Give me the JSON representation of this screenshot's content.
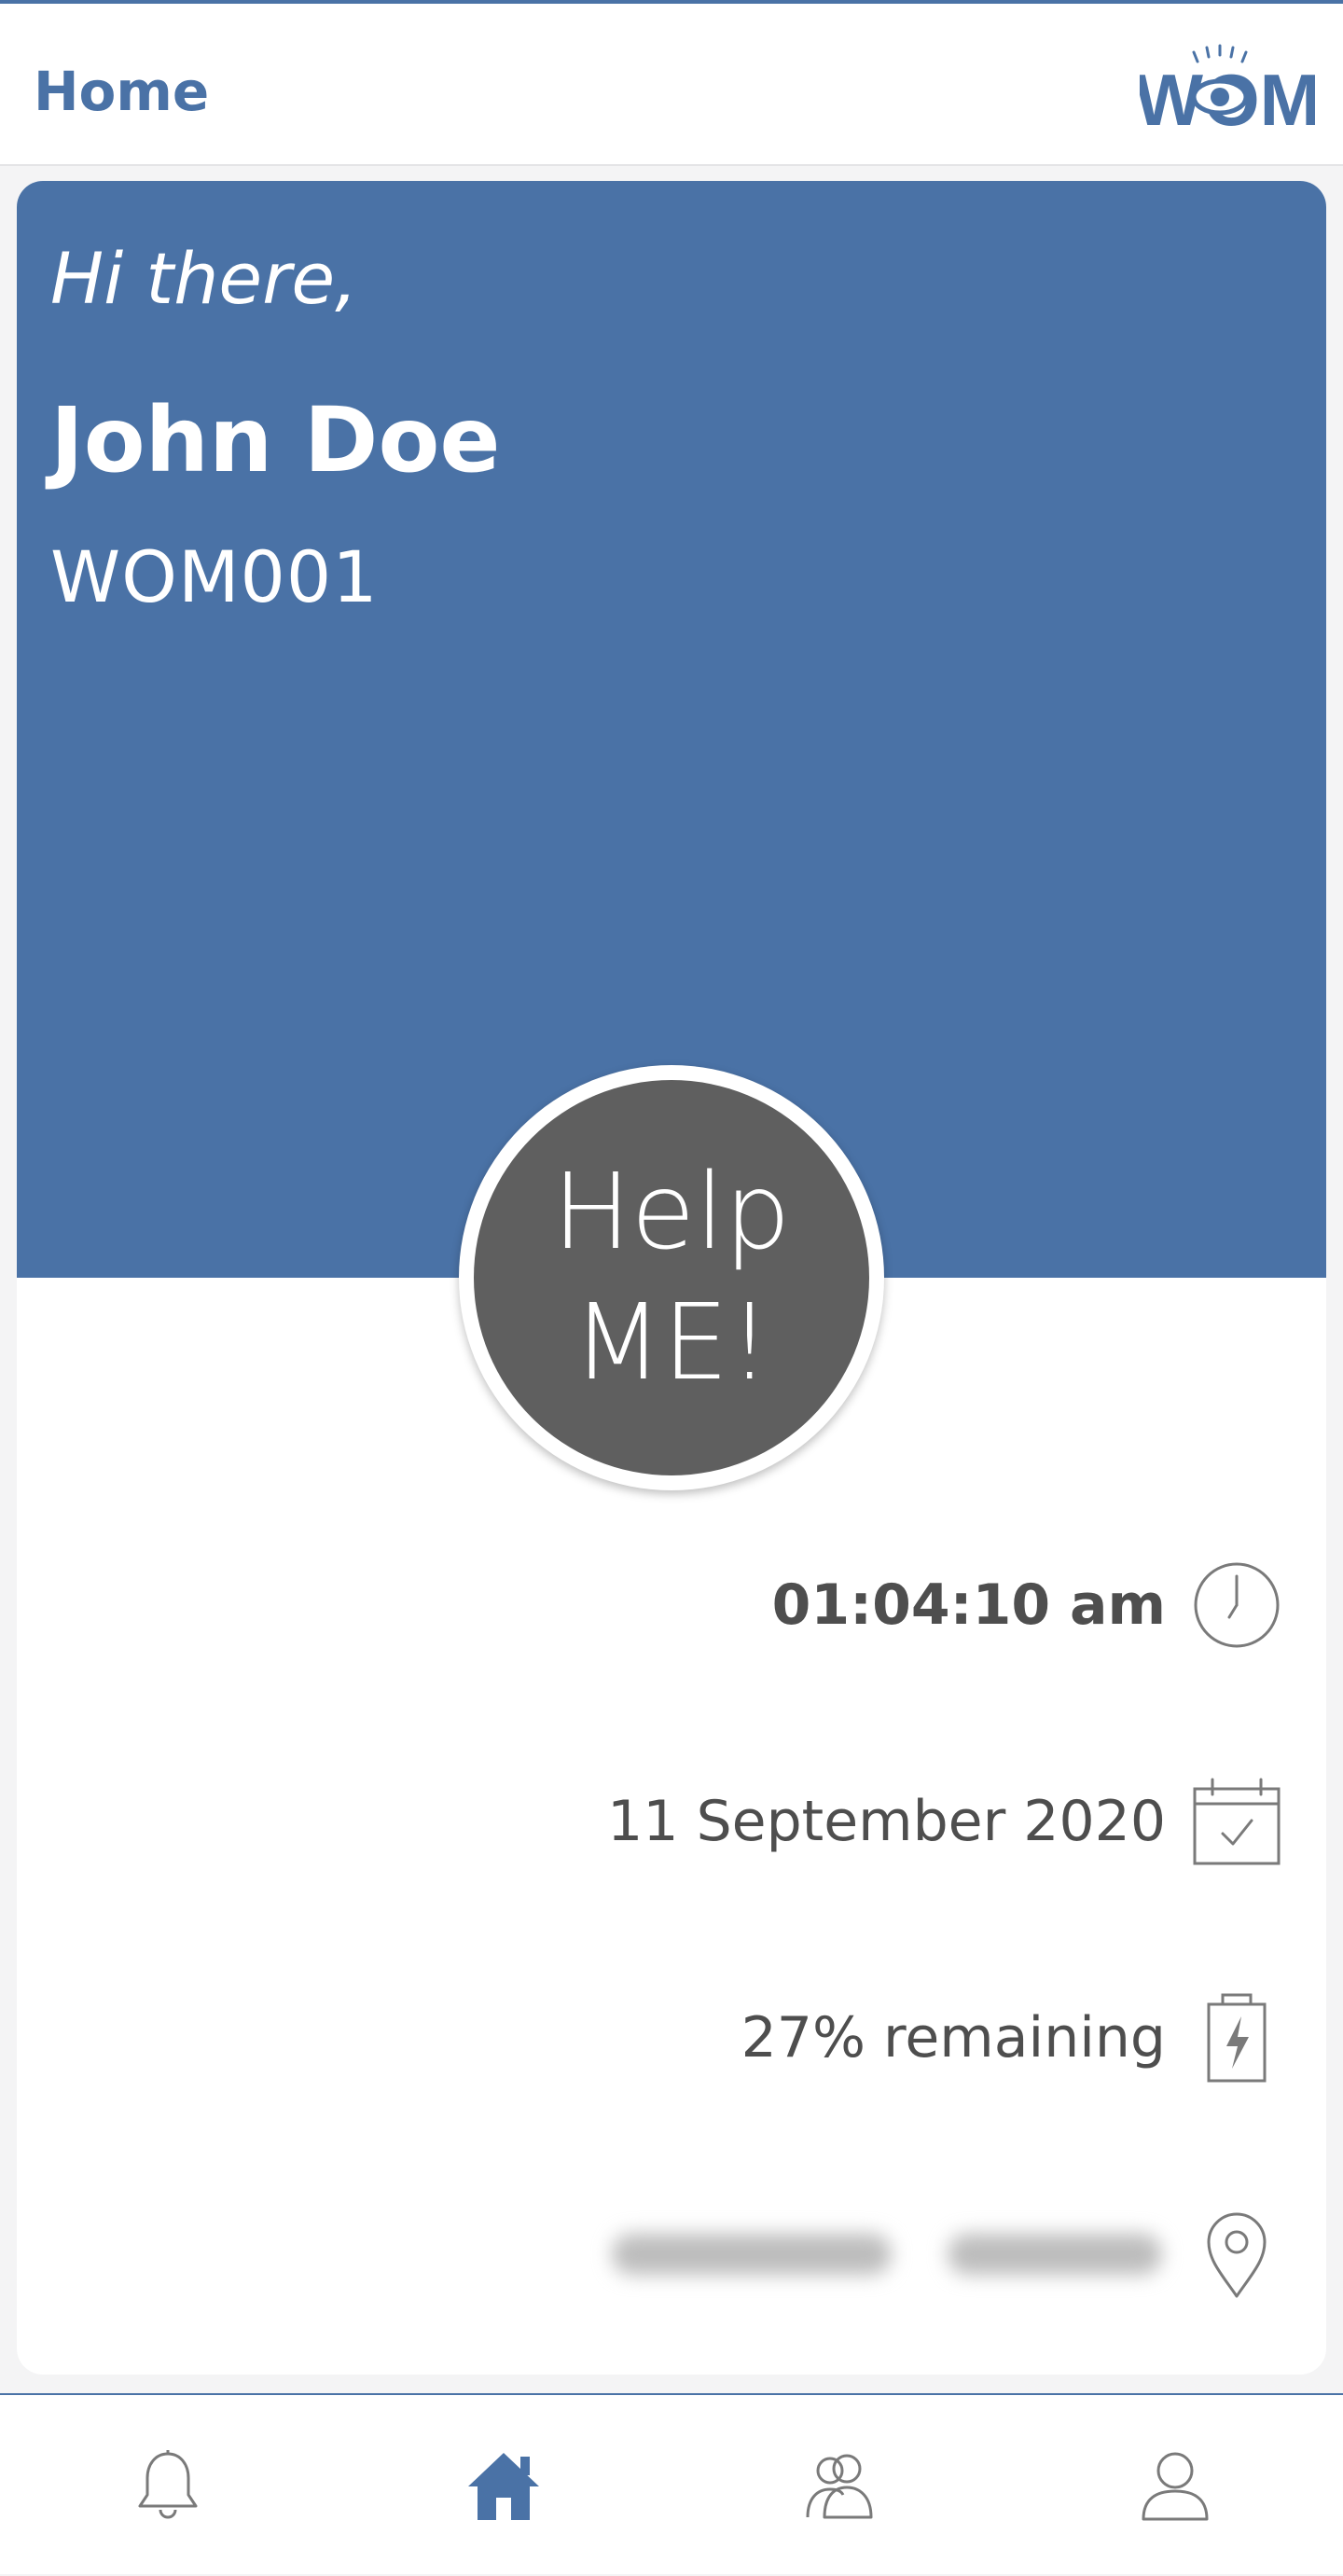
{
  "header": {
    "title": "Home",
    "logo_text": "WOM"
  },
  "hero": {
    "greeting": "Hi there,",
    "name": "John Doe",
    "user_id": "WOM001"
  },
  "help_button": {
    "line1": "Help",
    "line2": "ME!"
  },
  "info": {
    "time": "01:04:10 am",
    "date": "11 September 2020",
    "battery": "27% remaining",
    "icons": [
      "clock-icon",
      "calendar-check-icon",
      "battery-charging-icon",
      "location-pin-icon"
    ]
  },
  "tabbar": {
    "tabs": [
      "notifications",
      "home",
      "contacts",
      "profile"
    ],
    "active_tab": "home"
  },
  "colors": {
    "brand": "#4a72a6",
    "help_button": "#5f5f5f",
    "text": "#4e4e4e",
    "icon_gray": "#7a7a7a"
  }
}
